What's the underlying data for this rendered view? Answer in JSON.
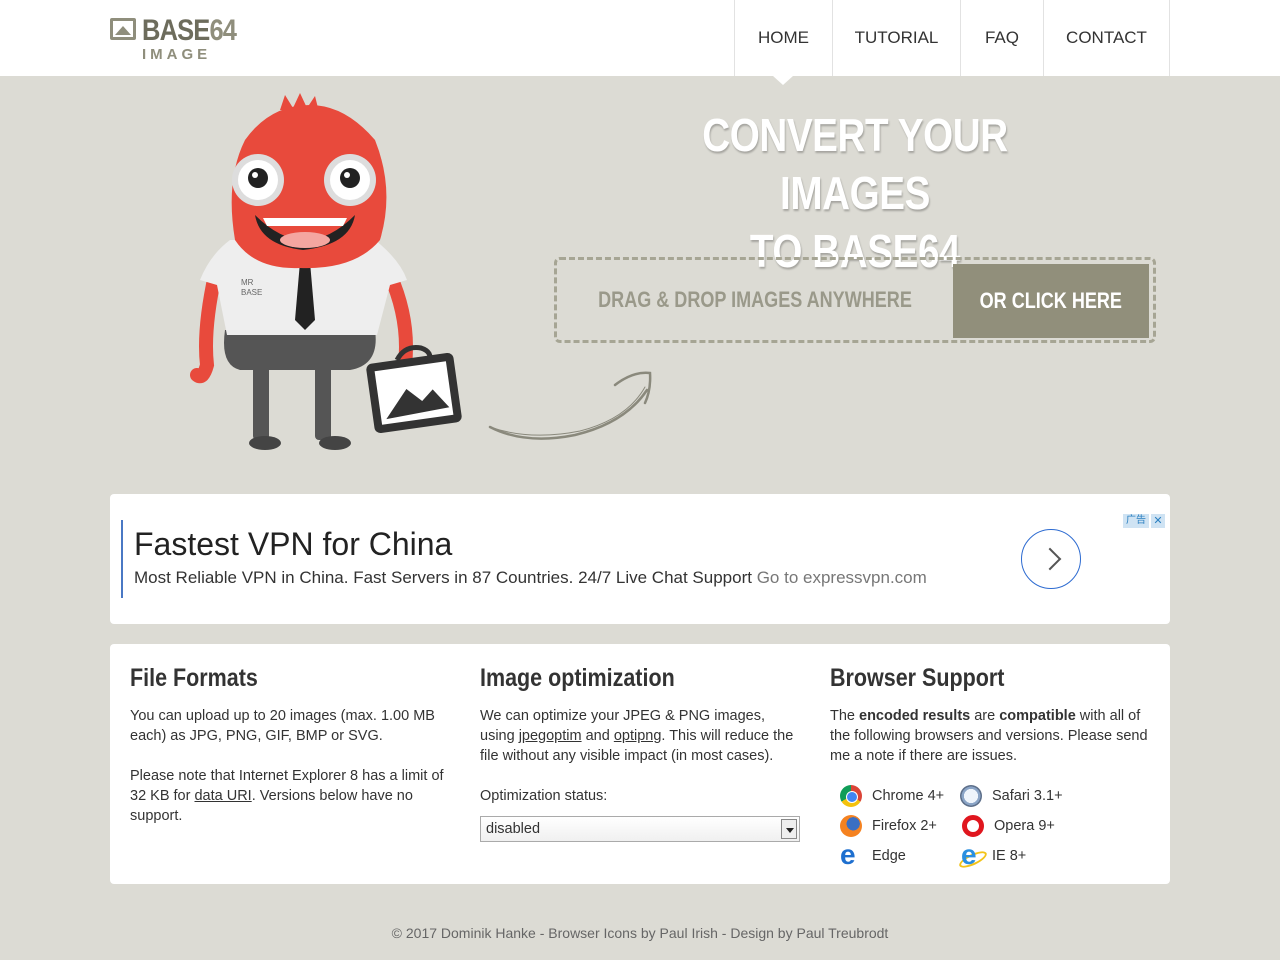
{
  "header": {
    "logo": {
      "word_main": "BASE",
      "word_accent": "64",
      "word_sub": "IMAGE"
    },
    "nav": [
      {
        "label": "HOME",
        "active": true
      },
      {
        "label": "TUTORIAL",
        "active": false
      },
      {
        "label": "FAQ",
        "active": false
      },
      {
        "label": "CONTACT",
        "active": false
      }
    ]
  },
  "hero": {
    "title_line1": "CONVERT YOUR IMAGES",
    "title_line2": "TO BASE64",
    "drop_text": "DRAG & DROP IMAGES ANYWHERE",
    "click_label": "OR CLICK HERE",
    "mascot_badge": [
      "MR",
      "BASE"
    ]
  },
  "ad": {
    "title": "Fastest VPN for China",
    "description": "Most Reliable VPN in China. Fast Servers in 87 Countries. 24/7 Live Chat Support",
    "link_text": "Go to expressvpn.com",
    "badge_label": "广告",
    "close_label": "✕"
  },
  "info": {
    "formats": {
      "title": "File Formats",
      "para1": "You can upload up to 20 images (max. 1.00 MB each) as JPG, PNG, GIF, BMP or SVG.",
      "para2_before": "Please note that Internet Explorer 8 has a limit of 32 KB for ",
      "para2_link": "data URI",
      "para2_after": ". Versions below have no support."
    },
    "optimization": {
      "title": "Image optimization",
      "text_before": "We can optimize your JPEG & PNG images, using ",
      "link1": "jpegoptim",
      "text_mid": " and ",
      "link2": "optipng",
      "text_after": ". This will reduce the file without any visible impact (in most cases).",
      "status_label": "Optimization status:",
      "status_value": "disabled"
    },
    "support": {
      "title": "Browser Support",
      "text_1": "The ",
      "bold_1": "encoded results",
      "text_2": " are ",
      "bold_2": "compatible",
      "text_3": " with all of the following browsers and versions. Please send me a note if there are issues.",
      "browsers": [
        {
          "name": "Chrome 4+",
          "icon": "chrome-icon"
        },
        {
          "name": "Safari 3.1+",
          "icon": "safari-icon"
        },
        {
          "name": "Firefox 2+",
          "icon": "firefox-icon"
        },
        {
          "name": "Opera 9+",
          "icon": "opera-icon"
        },
        {
          "name": "Edge",
          "icon": "edge-icon"
        },
        {
          "name": "IE 8+",
          "icon": "ie-icon"
        }
      ]
    }
  },
  "footer": {
    "text": "© 2017 Dominik Hanke - Browser Icons by Paul Irish - Design by Paul Treubrodt"
  },
  "colors": {
    "page_bg": "#dcdbd4",
    "accent": "#918f7b",
    "mascot_red": "#e84a3c",
    "link_blue": "#2d6bd1"
  }
}
